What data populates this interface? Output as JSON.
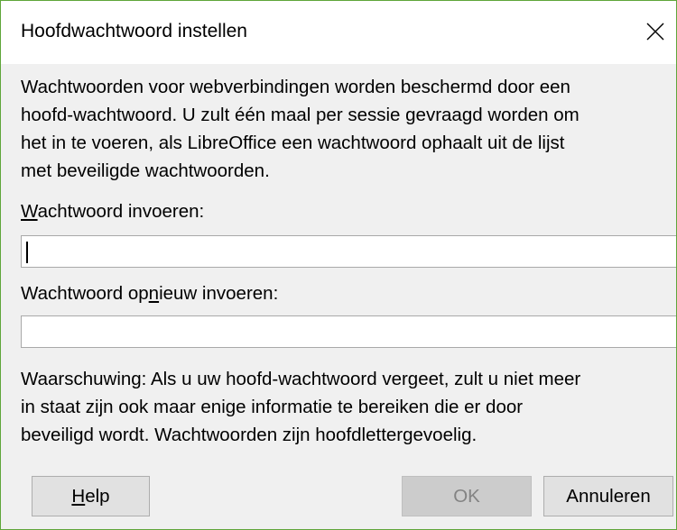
{
  "window": {
    "title": "Hoofdwachtwoord instellen"
  },
  "intro_lines": [
    "Wachtwoorden voor webverbindingen worden beschermd door een",
    "hoofd-wachtwoord. U zult één maal per sessie gevraagd worden om",
    "het in te voeren, als LibreOffice een wachtwoord ophaalt uit de lijst",
    "met beveiligde wachtwoorden."
  ],
  "password_label": {
    "mnemonic": "W",
    "rest": "achtwoord invoeren:"
  },
  "password_value": "",
  "confirm_label": {
    "before": "Wachtwoord op",
    "mnemonic": "n",
    "after": "ieuw invoeren:"
  },
  "confirm_value": "",
  "warning_lines": [
    "Waarschuwing: Als u uw hoofd-wachtwoord vergeet, zult u niet meer",
    "in staat zijn ook maar enige informatie te bereiken die er door",
    "beveiligd wordt. Wachtwoorden zijn hoofdlettergevoelig."
  ],
  "buttons": {
    "help": {
      "mnemonic": "H",
      "rest": "elp"
    },
    "ok": "OK",
    "cancel": "Annuleren"
  },
  "icons": {
    "close": "close-icon"
  }
}
